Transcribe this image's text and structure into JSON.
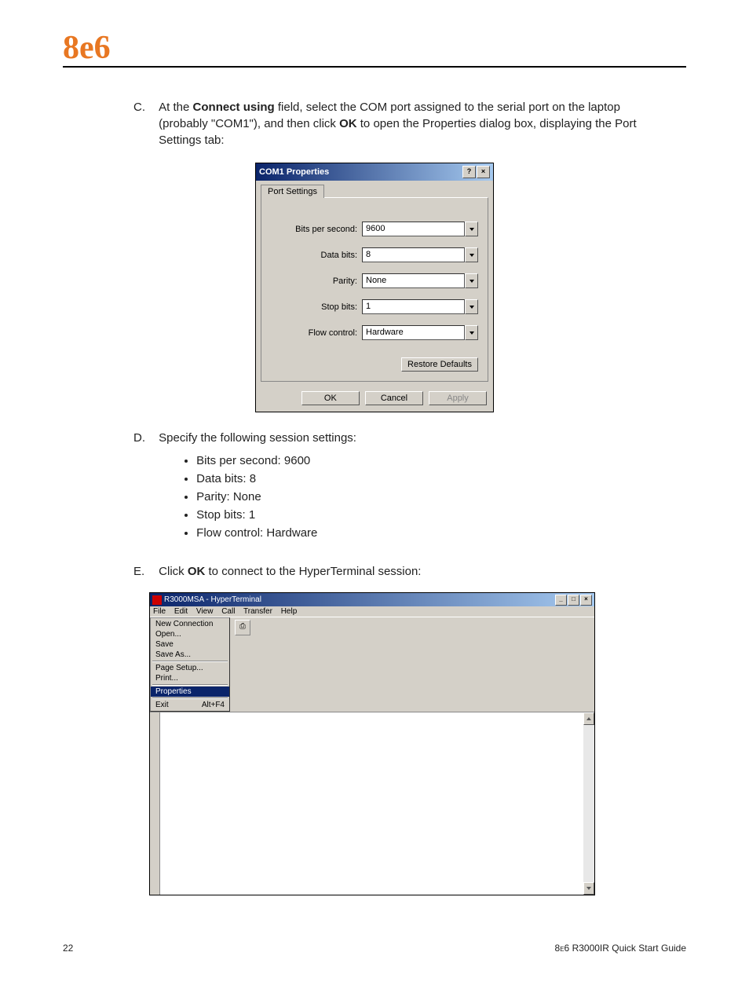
{
  "header": {
    "logo": "8e6"
  },
  "steps": {
    "c": {
      "letter": "C.",
      "pre": "At the ",
      "bold1": "Connect using",
      "mid1": " field, select the COM port assigned to the serial port on the laptop (probably \"COM1\"), and then click ",
      "bold2": "OK",
      "mid2": " to open the Properties dialog box, displaying the Port Settings tab:"
    },
    "d": {
      "letter": "D.",
      "text": "Specify the following session settings:",
      "bullets": [
        "Bits per second: 9600",
        "Data bits: 8",
        "Parity: None",
        "Stop bits: 1",
        "Flow control: Hardware"
      ]
    },
    "e": {
      "letter": "E.",
      "pre": "Click ",
      "bold": "OK",
      "post": " to connect to the HyperTerminal session:"
    }
  },
  "dialog": {
    "title": "COM1 Properties",
    "help_btn": "?",
    "close_btn": "×",
    "tab": "Port Settings",
    "fields": {
      "bps": {
        "label": "Bits per second:",
        "value": "9600"
      },
      "databits": {
        "label": "Data bits:",
        "value": "8"
      },
      "parity": {
        "label": "Parity:",
        "value": "None"
      },
      "stopbits": {
        "label": "Stop bits:",
        "value": "1"
      },
      "flow": {
        "label": "Flow control:",
        "value": "Hardware"
      }
    },
    "restore": "Restore Defaults",
    "ok": "OK",
    "cancel": "Cancel",
    "apply": "Apply"
  },
  "hyper": {
    "title": "R3000MSA - HyperTerminal",
    "min": "_",
    "max": "□",
    "close": "×",
    "menus": {
      "file": "File",
      "edit": "Edit",
      "view": "View",
      "call": "Call",
      "transfer": "Transfer",
      "help": "Help"
    },
    "file_menu": {
      "new": "New Connection",
      "open": "Open...",
      "save": "Save",
      "saveas": "Save As...",
      "pagesetup": "Page Setup...",
      "print": "Print...",
      "properties": "Properties",
      "exit": "Exit",
      "exit_key": "Alt+F4"
    }
  },
  "footer": {
    "page": "22",
    "guide_pre": "8e6 R3000IR Q",
    "guide_mid": "uick ",
    "guide_s": "S",
    "guide_mid2": "tart ",
    "guide_g": "G",
    "guide_end": "uide"
  }
}
